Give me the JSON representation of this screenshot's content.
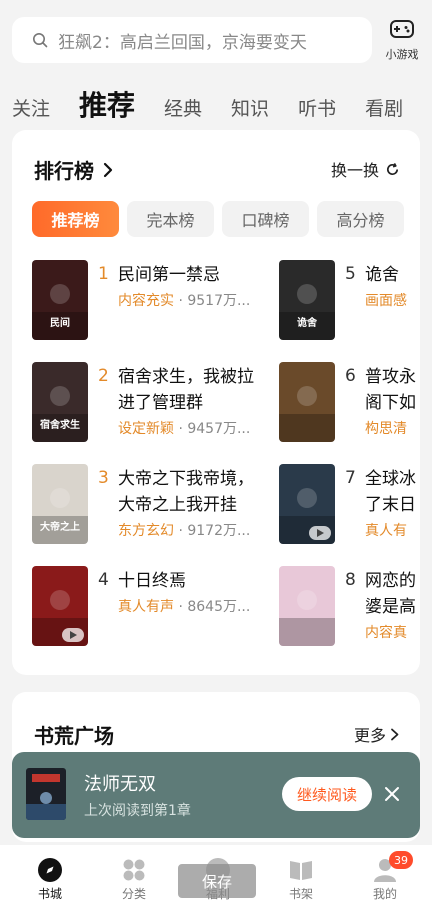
{
  "search": {
    "placeholder": "狂飙2：高启兰回国，京海要变天"
  },
  "mini_game": {
    "label": "小游戏"
  },
  "tabs": [
    {
      "label": "关注"
    },
    {
      "label": "推荐",
      "active": true
    },
    {
      "label": "经典"
    },
    {
      "label": "知识"
    },
    {
      "label": "听书"
    },
    {
      "label": "看剧"
    }
  ],
  "ranking": {
    "title": "排行榜",
    "switch_label": "换一换",
    "pills": [
      {
        "label": "推荐榜",
        "active": true
      },
      {
        "label": "完本榜"
      },
      {
        "label": "口碑榜"
      },
      {
        "label": "高分榜"
      }
    ],
    "items": [
      {
        "rank": "1",
        "title": "民间第一禁忌",
        "tag": "内容充实",
        "count": "· 9517万...",
        "cover_color": "#3b1a1a",
        "cover_text": "民间"
      },
      {
        "rank": "2",
        "title": "宿舍求生，我被拉",
        "title2": "进了管理群",
        "tag": "设定新颖",
        "count": "· 9457万...",
        "cover_color": "#3a2a2a",
        "cover_text": "宿舍求生"
      },
      {
        "rank": "3",
        "title": "大帝之下我帝境，",
        "title2": "大帝之上我开挂",
        "tag": "东方玄幻",
        "count": "· 9172万...",
        "cover_color": "#d9d4cc",
        "cover_text": "大帝之上"
      },
      {
        "rank": "4",
        "title": "十日终焉",
        "tag": "真人有声",
        "count": "· 8645万...",
        "cover_color": "#8a1a1a",
        "cover_text": "",
        "audio": true
      },
      {
        "rank": "5",
        "title": "诡舍",
        "tag": "画面感",
        "count": "",
        "cover_color": "#2a2a2a",
        "cover_text": "诡舍"
      },
      {
        "rank": "6",
        "title": "普攻永",
        "title2": "阁下如",
        "tag": "构思清",
        "count": "",
        "cover_color": "#6a4a2a",
        "cover_text": ""
      },
      {
        "rank": "7",
        "title": "全球冰",
        "title2": "了末日",
        "tag": "真人有",
        "count": "",
        "cover_color": "#2a3a4a",
        "cover_text": "",
        "audio": true
      },
      {
        "rank": "8",
        "title": "网恋的",
        "title2": "婆是高",
        "tag": "内容真",
        "count": "",
        "cover_color": "#e8c8d8",
        "cover_text": "",
        "audio": false
      }
    ]
  },
  "square": {
    "title": "书荒广场",
    "more_label": "更多"
  },
  "continue_reading": {
    "title": "法师无双",
    "subtitle": "上次阅读到第1章",
    "button": "继续阅读"
  },
  "nav": [
    {
      "label": "书城",
      "icon": "compass-icon",
      "active": true
    },
    {
      "label": "分类",
      "icon": "grid-icon"
    },
    {
      "label": "福利",
      "icon": "gift-icon"
    },
    {
      "label": "书架",
      "icon": "book-icon"
    },
    {
      "label": "我的",
      "icon": "user-icon",
      "badge": "39"
    }
  ],
  "save_label": "保存",
  "colors": {
    "accent": "#ff6a2a",
    "tag": "#e38a2a",
    "continue_bg": "#5e7b78"
  }
}
